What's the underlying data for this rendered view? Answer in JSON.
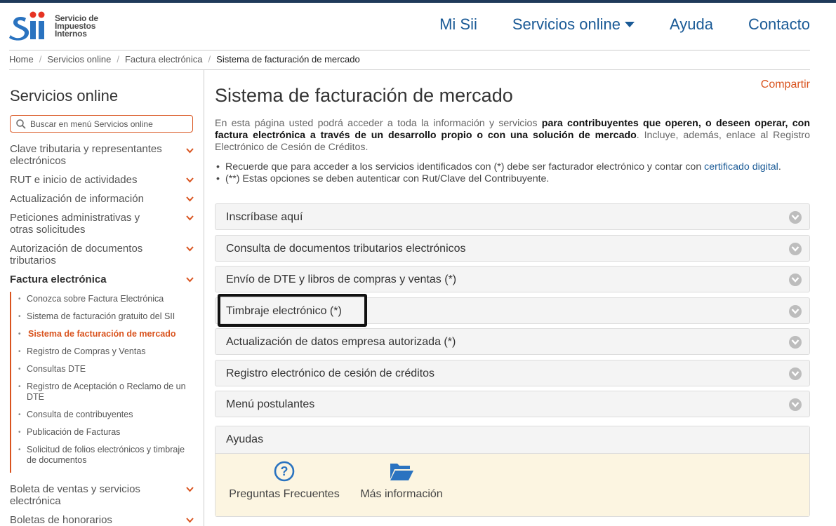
{
  "header": {
    "logo_lines": [
      "Servicio de",
      "Impuestos",
      "Internos"
    ],
    "nav": [
      {
        "label": "Mi Sii"
      },
      {
        "label": "Servicios online"
      },
      {
        "label": "Ayuda"
      },
      {
        "label": "Contacto"
      }
    ]
  },
  "breadcrumb": [
    "Home",
    "Servicios online",
    "Factura electrónica",
    "Sistema de facturación de mercado"
  ],
  "sidebar": {
    "title": "Servicios online",
    "search_placeholder": "Buscar en menú Servicios online",
    "items": [
      {
        "label": "Clave tributaria y representantes electrónicos"
      },
      {
        "label": "RUT e inicio de actividades"
      },
      {
        "label": "Actualización de información"
      },
      {
        "label": "Peticiones administrativas y otras solicitudes"
      },
      {
        "label": "Autorización de documentos tributarios"
      },
      {
        "label": "Factura electrónica"
      }
    ],
    "sub_items": [
      {
        "label": "Conozca sobre Factura Electrónica"
      },
      {
        "label": "Sistema de facturación gratuito del SII"
      },
      {
        "label": "Sistema de facturación de mercado"
      },
      {
        "label": "Registro de Compras y Ventas"
      },
      {
        "label": "Consultas DTE"
      },
      {
        "label": "Registro de Aceptación o Reclamo de un DTE"
      },
      {
        "label": "Consulta de contribuyentes"
      },
      {
        "label": "Publicación de Facturas"
      },
      {
        "label": "Solicitud de folios electrónicos y timbraje de documentos"
      }
    ],
    "items_after": [
      {
        "label": "Boleta de ventas y servicios electrónica"
      },
      {
        "label": "Boletas de honorarios electrónicas"
      }
    ]
  },
  "main": {
    "share": "Compartir",
    "title": "Sistema de facturación de mercado",
    "intro_1": "En esta página usted podrá acceder a toda la información y servicios ",
    "intro_bold": "para contribuyentes que operen, o deseen operar, con factura electrónica a través de un desarrollo propio o con una solución de mercado",
    "intro_2": ". Incluye, además, enlace al Registro Electrónico de Cesión de Créditos.",
    "bullet_1": "Recuerde que para acceder a los servicios identificados con (*) debe ser facturador electrónico y contar con ",
    "bullet_1_link": "certificado digital",
    "bullet_1_end": ".",
    "bullet_2": "(**) Estas opciones se deben autenticar con Rut/Clave del Contribuyente.",
    "accordion": [
      {
        "label": "Inscríbase aquí"
      },
      {
        "label": "Consulta de documentos tributarios electrónicos"
      },
      {
        "label": "Envío de DTE y libros de compras y ventas (*)"
      },
      {
        "label": "Timbraje electrónico (*)"
      },
      {
        "label": "Actualización de datos empresa autorizada (*)"
      },
      {
        "label": "Registro electrónico de cesión de créditos"
      },
      {
        "label": "Menú postulantes"
      }
    ],
    "ayudas": {
      "title": "Ayudas",
      "items": [
        {
          "label": "Preguntas Frecuentes",
          "icon": "question-circle-icon"
        },
        {
          "label": "Más información",
          "icon": "folder-open-icon"
        }
      ]
    }
  },
  "colors": {
    "accent_orange": "#d9541f",
    "link_blue": "#1a5a96",
    "logo_blue": "#2a73c0"
  }
}
